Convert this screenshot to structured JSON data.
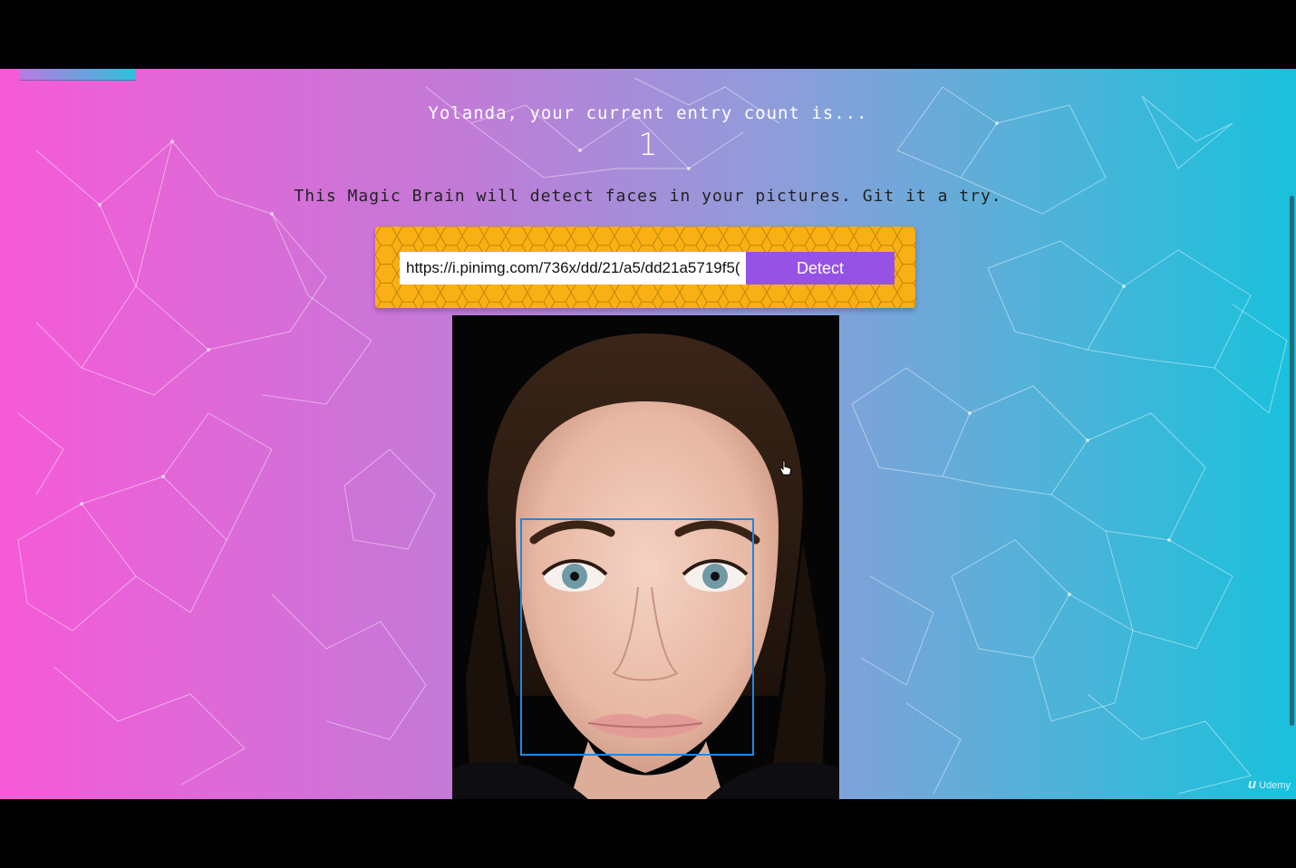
{
  "rank": {
    "message": "Yolanda, your current entry count is...",
    "count": "1"
  },
  "tagline": "This Magic Brain will detect faces in your pictures. Git it a try.",
  "form": {
    "url_value": "https://i.pinimg.com/736x/dd/21/a5/dd21a5719f5(",
    "detect_label": "Detect"
  },
  "watermark": {
    "logo": "u",
    "text": "Udemy"
  },
  "colors": {
    "gradient_start": "#f65ad7",
    "gradient_end": "#19c1dc",
    "panel": "#f9b014",
    "button": "#9552e4",
    "face_box": "#1e88e5"
  },
  "icons": {
    "cursor": "hand-pointer-icon",
    "logo": "udemy-logo-icon"
  }
}
